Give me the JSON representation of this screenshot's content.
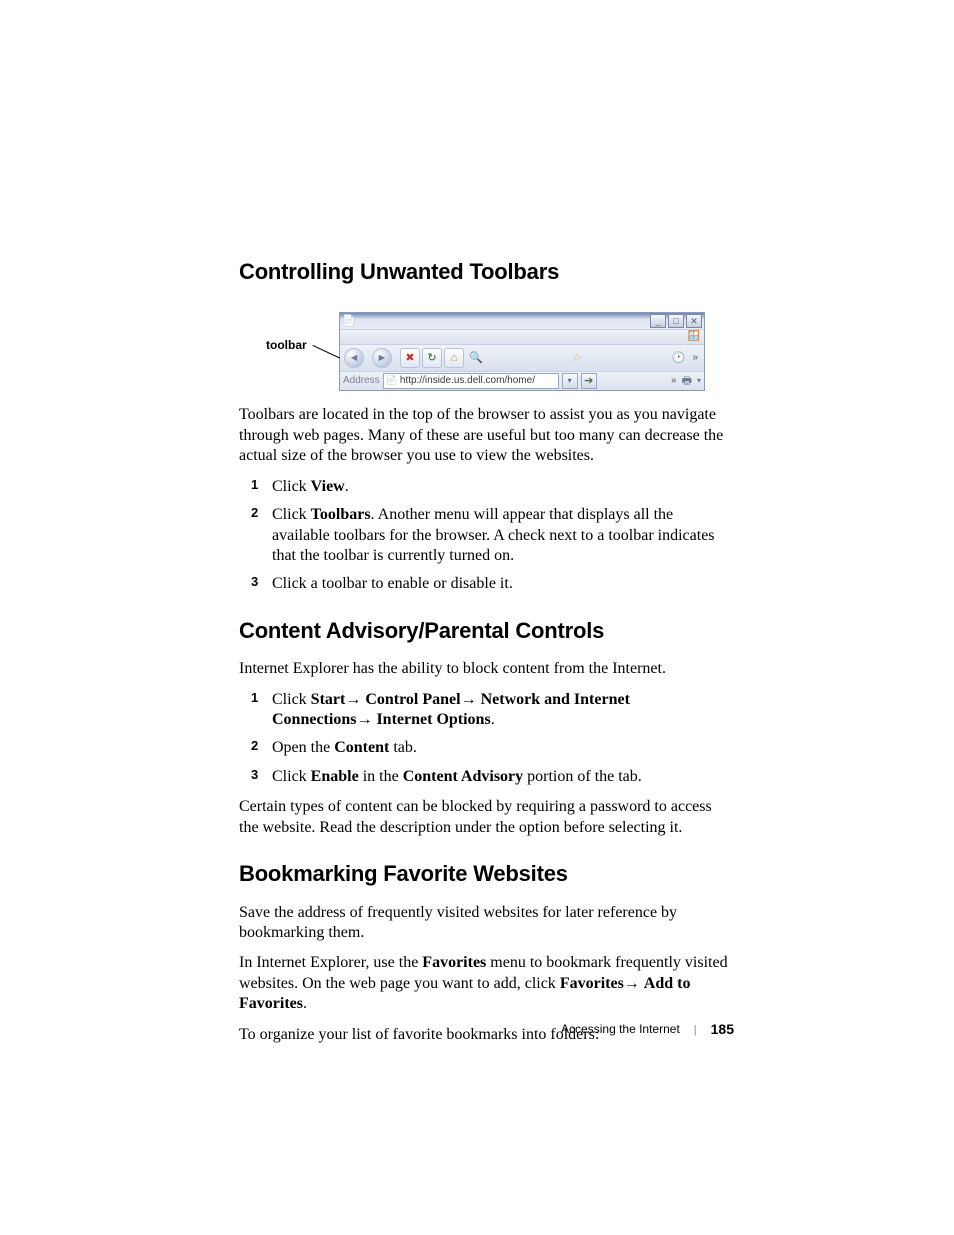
{
  "headings": {
    "h1": "Controlling Unwanted Toolbars",
    "h2": "Content Advisory/Parental Controls",
    "h3": "Bookmarking Favorite Websites"
  },
  "labels": {
    "toolbar": "toolbar"
  },
  "ie": {
    "address_label": "Address",
    "url": "http://inside.us.dell.com/home/"
  },
  "body": {
    "p1": "Toolbars are located in the top of the browser to assist you as you navigate through web pages. Many of these are useful but too many can decrease the actual size of the browser you use to view the websites.",
    "s1_1a": "Click ",
    "s1_1b": "View",
    "s1_1c": ".",
    "s1_2a": "Click ",
    "s1_2b": "Toolbars",
    "s1_2c": ". Another menu will appear that displays all the available toolbars for the browser. A check next to a toolbar indicates that the toolbar is currently turned on.",
    "s1_3": "Click a toolbar to enable or disable it.",
    "p2": "Internet Explorer has the ability to block content from the Internet.",
    "s2_1a": "Click ",
    "s2_1b": "Start",
    "s2_1c": "→ ",
    "s2_1d": "Control Panel",
    "s2_1e": "→ ",
    "s2_1f": "Network and Internet Connections",
    "s2_1g": "→ ",
    "s2_1h": "Internet Options",
    "s2_1i": ".",
    "s2_2a": "Open the ",
    "s2_2b": "Content",
    "s2_2c": " tab.",
    "s2_3a": "Click ",
    "s2_3b": "Enable",
    "s2_3c": " in the ",
    "s2_3d": "Content Advisory",
    "s2_3e": " portion of the tab.",
    "p3": "Certain types of content can be blocked by requiring a password to access the website. Read the description under the option before selecting it.",
    "p4": "Save the address of frequently visited websites for later reference by bookmarking them.",
    "p5a": "In Internet Explorer, use the ",
    "p5b": "Favorites",
    "p5c": " menu to bookmark frequently visited websites. On the web page you want to add, click ",
    "p5d": "Favorites",
    "p5e": "→ ",
    "p5f": "Add to Favorites",
    "p5g": ".",
    "p6": "To organize your list of favorite bookmarks into folders:"
  },
  "footer": {
    "section": "Accessing the Internet",
    "page": "185"
  }
}
